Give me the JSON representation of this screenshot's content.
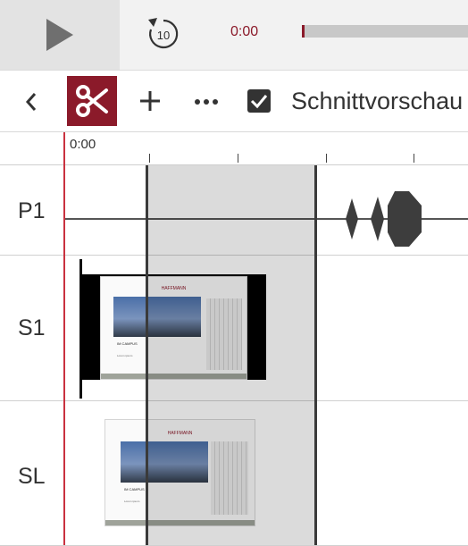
{
  "player": {
    "time": "0:00",
    "progress": 0.0,
    "rewind_seconds": "10",
    "accent_color": "#8b1a2a"
  },
  "toolbar": {
    "back_icon": "chevron-left-icon",
    "cut_icon": "scissors-icon",
    "add_icon": "plus-icon",
    "more_icon": "more-horizontal-icon",
    "preview_checked": true,
    "preview_label": "Schnittvorschau"
  },
  "timeline": {
    "ruler_start": "0:00",
    "playhead_color": "#c9323f",
    "tracks": [
      {
        "label": "P1"
      },
      {
        "label": "S1"
      },
      {
        "label": "SL"
      }
    ]
  },
  "thumbnails": {
    "brand": "HAFFMANN",
    "caption": "IM CAMPUS",
    "subcaption": "Lorem ipsum"
  }
}
